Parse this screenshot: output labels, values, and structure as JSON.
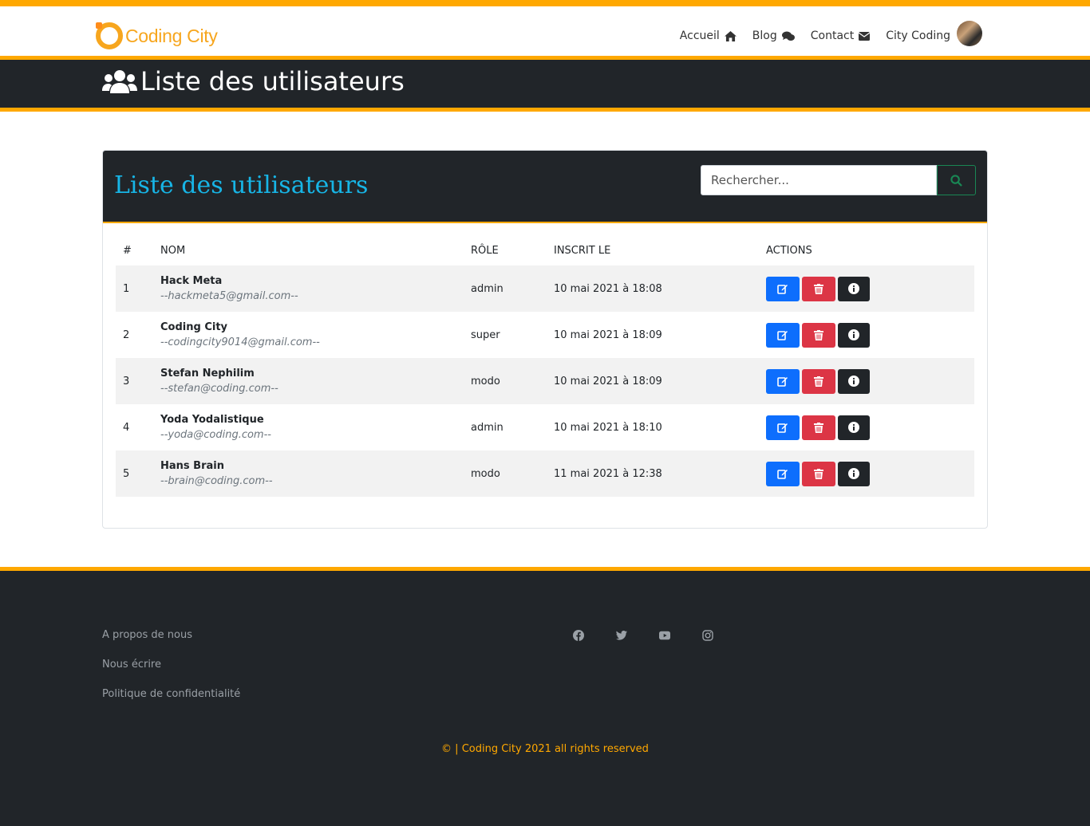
{
  "brand": {
    "name": "Coding City"
  },
  "nav": {
    "items": [
      {
        "label": "Accueil",
        "icon": "home-icon"
      },
      {
        "label": "Blog",
        "icon": "comments-icon"
      },
      {
        "label": "Contact",
        "icon": "envelope-icon"
      },
      {
        "label": "City Coding",
        "icon": "avatar"
      }
    ]
  },
  "page": {
    "title": "Liste des utilisateurs",
    "icon": "users-icon"
  },
  "card": {
    "title": "Liste des utilisateurs",
    "search_placeholder": "Rechercher..."
  },
  "table": {
    "headers": [
      "#",
      "NOM",
      "RÔLE",
      "INSCRIT LE",
      "ACTIONS"
    ],
    "rows": [
      {
        "id": "1",
        "name": "Hack Meta",
        "email": "--hackmeta5@gmail.com--",
        "role": "admin",
        "date": "10 mai 2021 à 18:08"
      },
      {
        "id": "2",
        "name": "Coding City",
        "email": "--codingcity9014@gmail.com--",
        "role": "super",
        "date": "10 mai 2021 à 18:09"
      },
      {
        "id": "3",
        "name": "Stefan Nephilim",
        "email": "--stefan@coding.com--",
        "role": "modo",
        "date": "10 mai 2021 à 18:09"
      },
      {
        "id": "4",
        "name": "Yoda Yodalistique",
        "email": "--yoda@coding.com--",
        "role": "admin",
        "date": "10 mai 2021 à 18:10"
      },
      {
        "id": "5",
        "name": "Hans Brain",
        "email": "--brain@coding.com--",
        "role": "modo",
        "date": "11 mai 2021 à 12:38"
      }
    ]
  },
  "footer": {
    "links": [
      "A propos de nous",
      "Nous écrire",
      "Politique de confidentialité"
    ],
    "social": [
      "facebook-icon",
      "twitter-icon",
      "youtube-icon",
      "instagram-icon"
    ],
    "copyright": "© | Coding City 2021 all rights reserved"
  },
  "colors": {
    "accent": "#ffa800",
    "dark": "#212529",
    "title": "#17b5e6",
    "edit": "#0d6efd",
    "delete": "#dc3545"
  }
}
